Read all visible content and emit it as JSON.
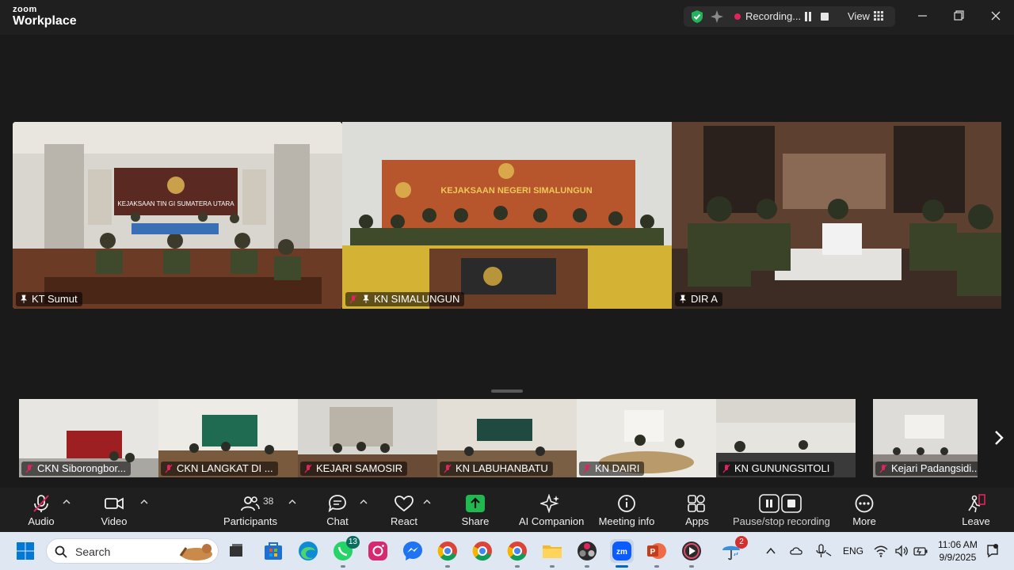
{
  "app": {
    "brand_top": "zoom",
    "brand_bottom": "Workplace"
  },
  "recording": {
    "label": "Recording...",
    "view_label": "View"
  },
  "gallery": {
    "main": [
      {
        "name": "KT Sumut",
        "active": true
      },
      {
        "name": "KN SIMALUNGUN",
        "active": false
      },
      {
        "name": "DIR A",
        "active": false
      }
    ],
    "strip": [
      {
        "name": "CKN Siborongbor..."
      },
      {
        "name": "CKN LANGKAT DI ..."
      },
      {
        "name": "KEJARI SAMOSIR"
      },
      {
        "name": "KN LABUHANBATU"
      },
      {
        "name": "KN DAIRI"
      },
      {
        "name": "KN GUNUNGSITOLI"
      },
      {
        "name": "Kejari Padangsidi..."
      }
    ],
    "scene_text": {
      "kt_sumut_banner": "KEJAKSAAN TIN   GI SUMATERA UTARA",
      "simalungun_banner": "KEJAKSAAN NEGERI SIMALUNGUN"
    }
  },
  "toolbar": {
    "audio": "Audio",
    "video": "Video",
    "participants": "Participants",
    "participants_count": "38",
    "chat": "Chat",
    "react": "React",
    "share": "Share",
    "ai_companion": "AI Companion",
    "meeting_info": "Meeting info",
    "apps": "Apps",
    "pause_stop": "Pause/stop recording",
    "more": "More",
    "leave": "Leave"
  },
  "taskbar": {
    "search_placeholder": "Search",
    "whatsapp_badge": "13",
    "weather_badge": "2",
    "lang": "ENG",
    "time": "11:06 AM",
    "date": "9/9/2025"
  },
  "colors": {
    "active_speaker": "#23d160",
    "share_green": "#1fb950",
    "muted_red": "#e0245e",
    "leave_red": "#e0245e"
  }
}
